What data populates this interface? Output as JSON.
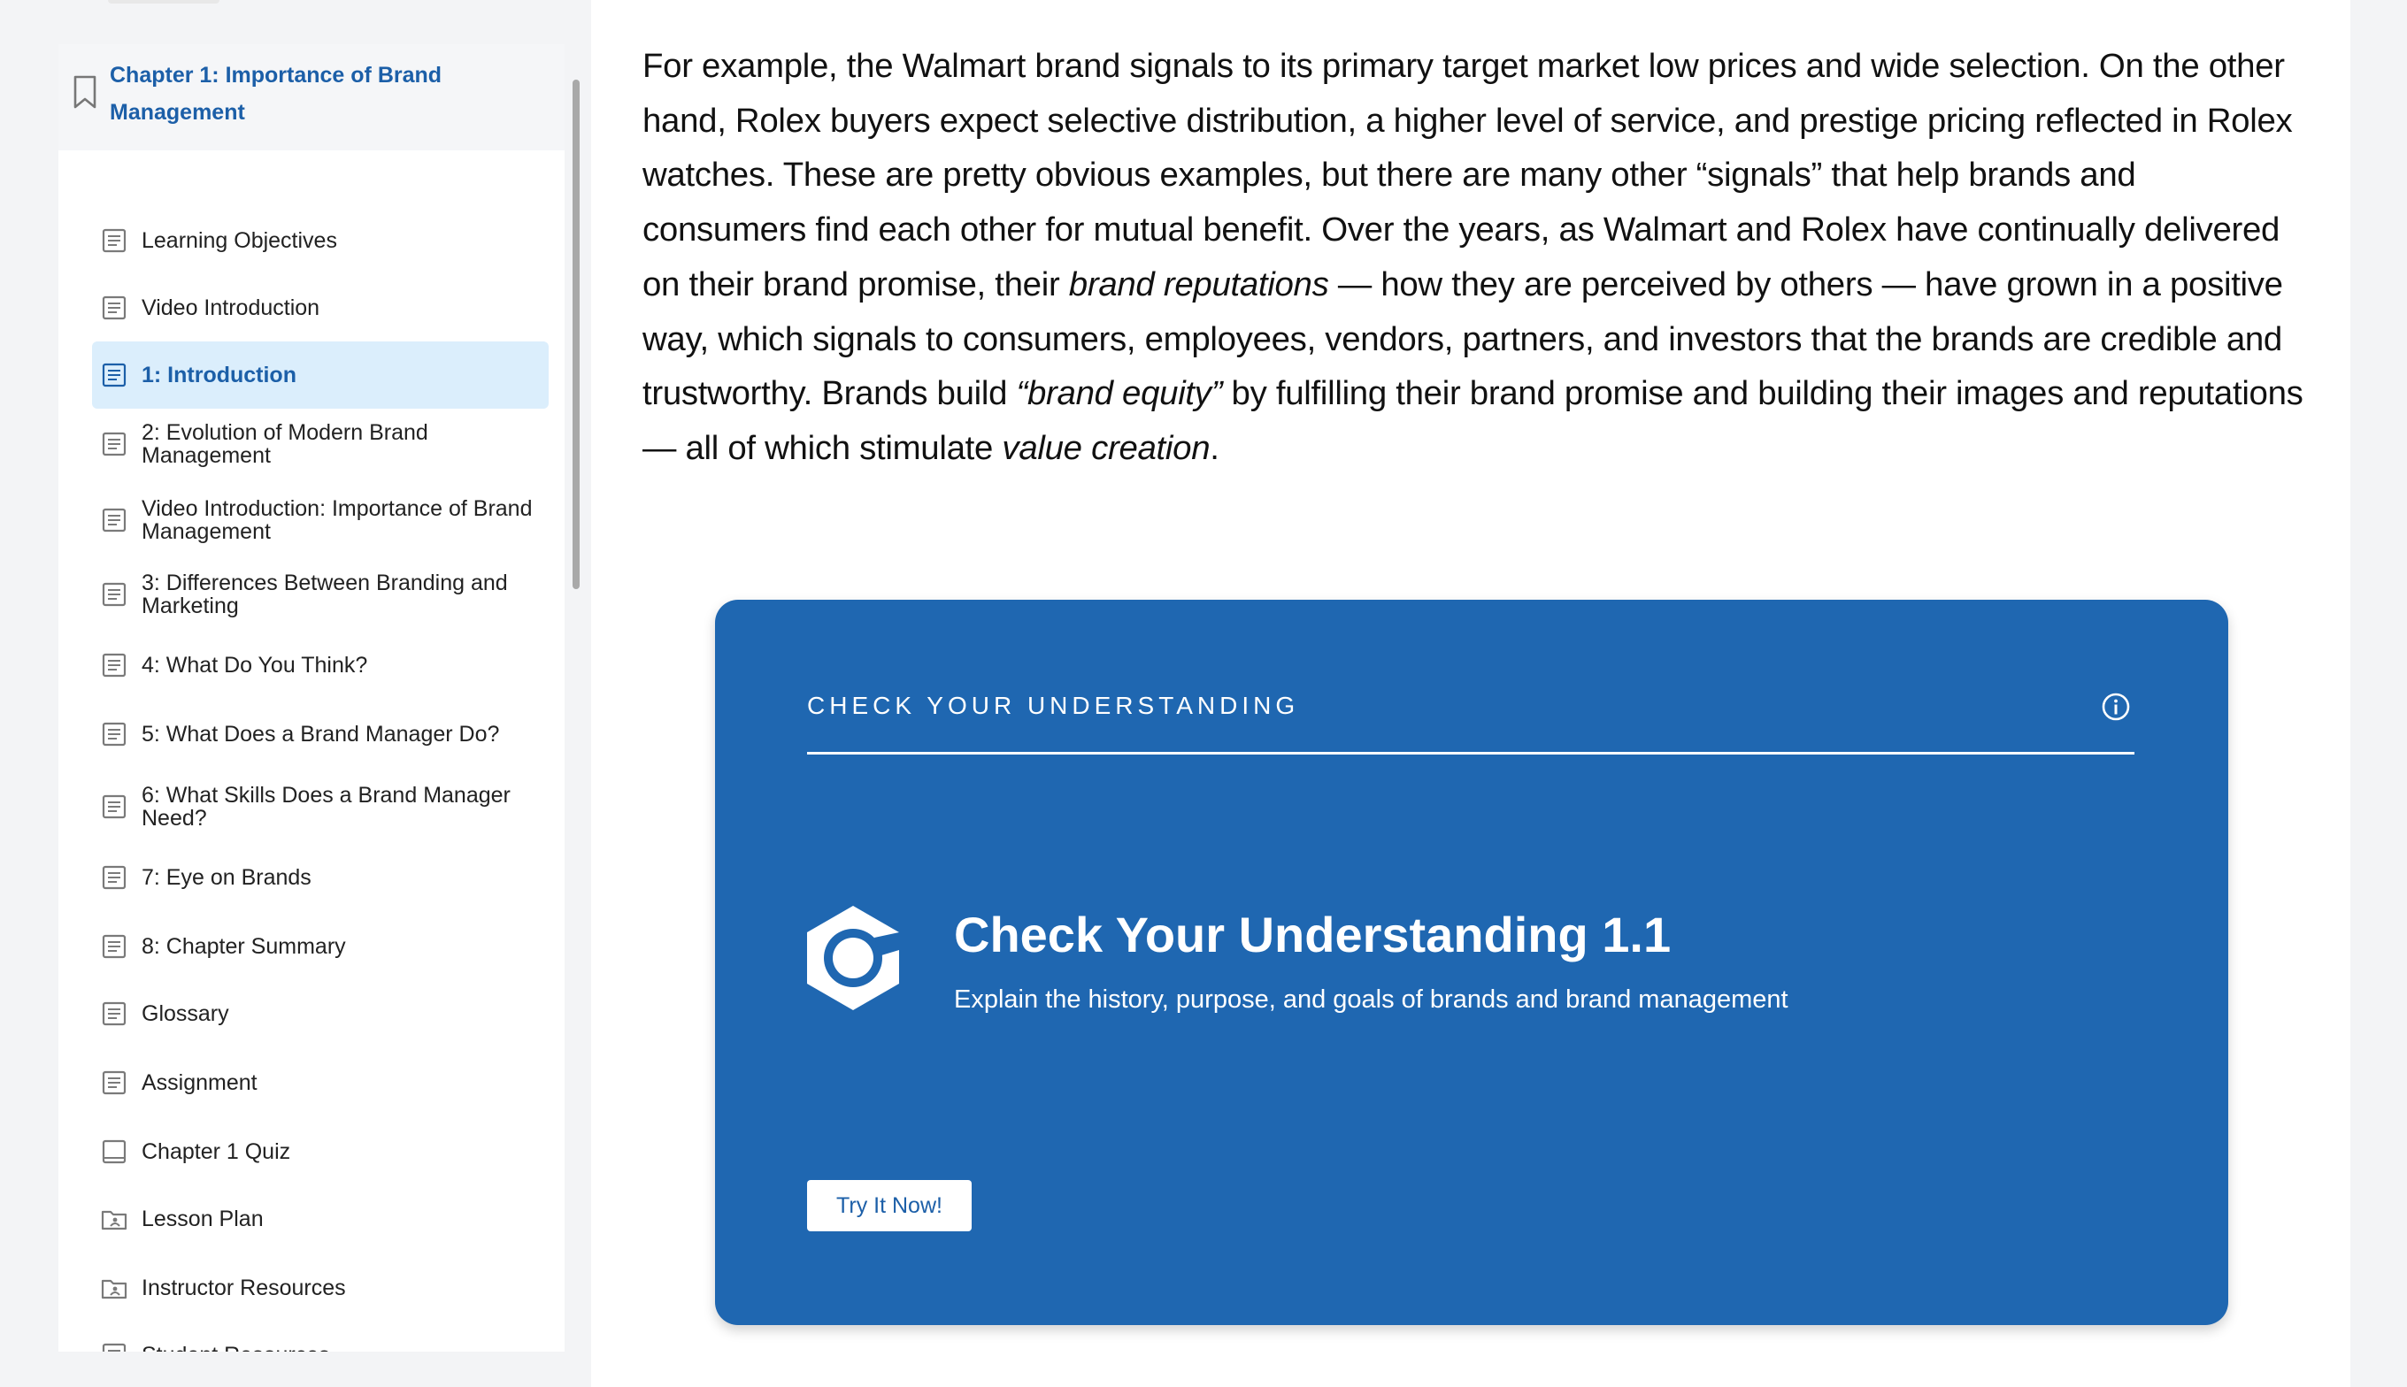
{
  "sidebar": {
    "chapter_title": "Chapter 1: Importance of Brand Management",
    "items": [
      {
        "label": "Learning Objectives",
        "icon": "page-icon"
      },
      {
        "label": "Video Introduction",
        "icon": "page-icon"
      },
      {
        "label": "1: Introduction",
        "icon": "page-icon",
        "active": true
      },
      {
        "label": "2: Evolution of Modern Brand Management",
        "icon": "page-icon"
      },
      {
        "label": "Video Introduction: Importance of Brand Management",
        "icon": "page-icon"
      },
      {
        "label": "3: Differences Between Branding and Marketing",
        "icon": "page-icon"
      },
      {
        "label": "4: What Do You Think?",
        "icon": "page-icon"
      },
      {
        "label": "5: What Does a Brand Manager Do?",
        "icon": "page-icon"
      },
      {
        "label": "6: What Skills Does a Brand Manager Need?",
        "icon": "page-icon"
      },
      {
        "label": "7: Eye on Brands",
        "icon": "page-icon"
      },
      {
        "label": "8: Chapter Summary",
        "icon": "page-icon"
      },
      {
        "label": "Glossary",
        "icon": "page-icon"
      },
      {
        "label": "Assignment",
        "icon": "page-icon"
      },
      {
        "label": "Chapter 1 Quiz",
        "icon": "quiz-icon"
      },
      {
        "label": "Lesson Plan",
        "icon": "folder-icon"
      },
      {
        "label": "Instructor Resources",
        "icon": "folder-icon"
      },
      {
        "label": "Student Resources",
        "icon": "page-icon"
      }
    ]
  },
  "content": {
    "paragraph": {
      "s1": "For example, the Walmart brand signals to its primary target market low prices and wide selection. On the other hand, Rolex buyers expect selective distribution, a higher level of service, and prestige pricing reflected in Rolex watches. These are pretty obvious examples, but there are many other “signals” that help brands and consumers find each other for mutual benefit. Over the years, as Walmart and Rolex have continually delivered on their brand promise, their ",
      "em1": "brand reputations",
      "s2": " — how they are perceived by others — have grown in a positive way, which signals to consumers, employees, vendors, partners, and investors that the brands are credible and trustworthy. Brands build ",
      "em2": "“brand equity”",
      "s3": " by fulfilling their brand promise and building their images and reputations — all of which stimulate ",
      "em3": "value creation",
      "s4": "."
    },
    "card": {
      "label": "CHECK YOUR UNDERSTANDING",
      "title": "Check Your Understanding 1.1",
      "subtitle": "Explain the history, purpose, and goals of brands and brand management",
      "button_label": "Try It Now!",
      "info_icon": "info-icon",
      "brand_icon": "hexagon-ring-icon"
    }
  },
  "colors": {
    "accent": "#1c5fa8",
    "card_bg": "#1f67b1",
    "active_item_bg": "#dbeefc"
  }
}
